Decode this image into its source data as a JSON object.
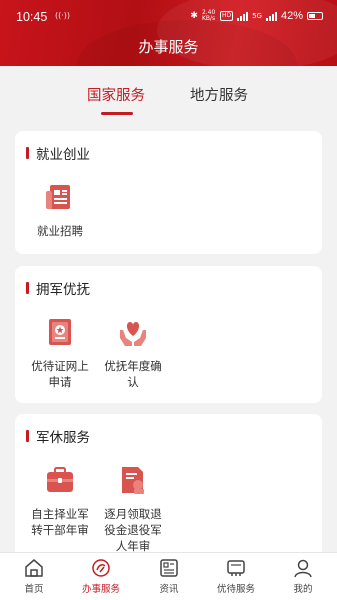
{
  "status_bar": {
    "time": "10:45",
    "nfc": "((·))",
    "speed": "2.40 KB/s",
    "hd": "HD",
    "network": "5G",
    "battery": "42%"
  },
  "header": {
    "title": "办事服务"
  },
  "tabs": [
    {
      "label": "国家服务",
      "active": true
    },
    {
      "label": "地方服务",
      "active": false
    }
  ],
  "sections": [
    {
      "title": "就业创业",
      "items": [
        {
          "label": "就业招聘",
          "icon": "newspaper-icon"
        }
      ]
    },
    {
      "title": "拥军优抚",
      "items": [
        {
          "label": "优待证网上申请",
          "icon": "certificate-icon"
        },
        {
          "label": "优抚年度确认",
          "icon": "heart-hands-icon"
        }
      ]
    },
    {
      "title": "军休服务",
      "items": [
        {
          "label": "自主择业军转干部年审",
          "icon": "briefcase-icon"
        },
        {
          "label": "逐月领取退役金退役军人年审",
          "icon": "document-seal-icon"
        }
      ]
    }
  ],
  "bottom_nav": [
    {
      "label": "首页",
      "icon": "home-icon",
      "active": false
    },
    {
      "label": "办事服务",
      "icon": "service-icon",
      "active": true
    },
    {
      "label": "资讯",
      "icon": "news-icon",
      "active": false
    },
    {
      "label": "优待服务",
      "icon": "ticket-icon",
      "active": false
    },
    {
      "label": "我的",
      "icon": "person-icon",
      "active": false
    }
  ],
  "colors": {
    "brand_red": "#c41a20",
    "background": "#f2f2f2",
    "icon_red": "#d9534f"
  }
}
